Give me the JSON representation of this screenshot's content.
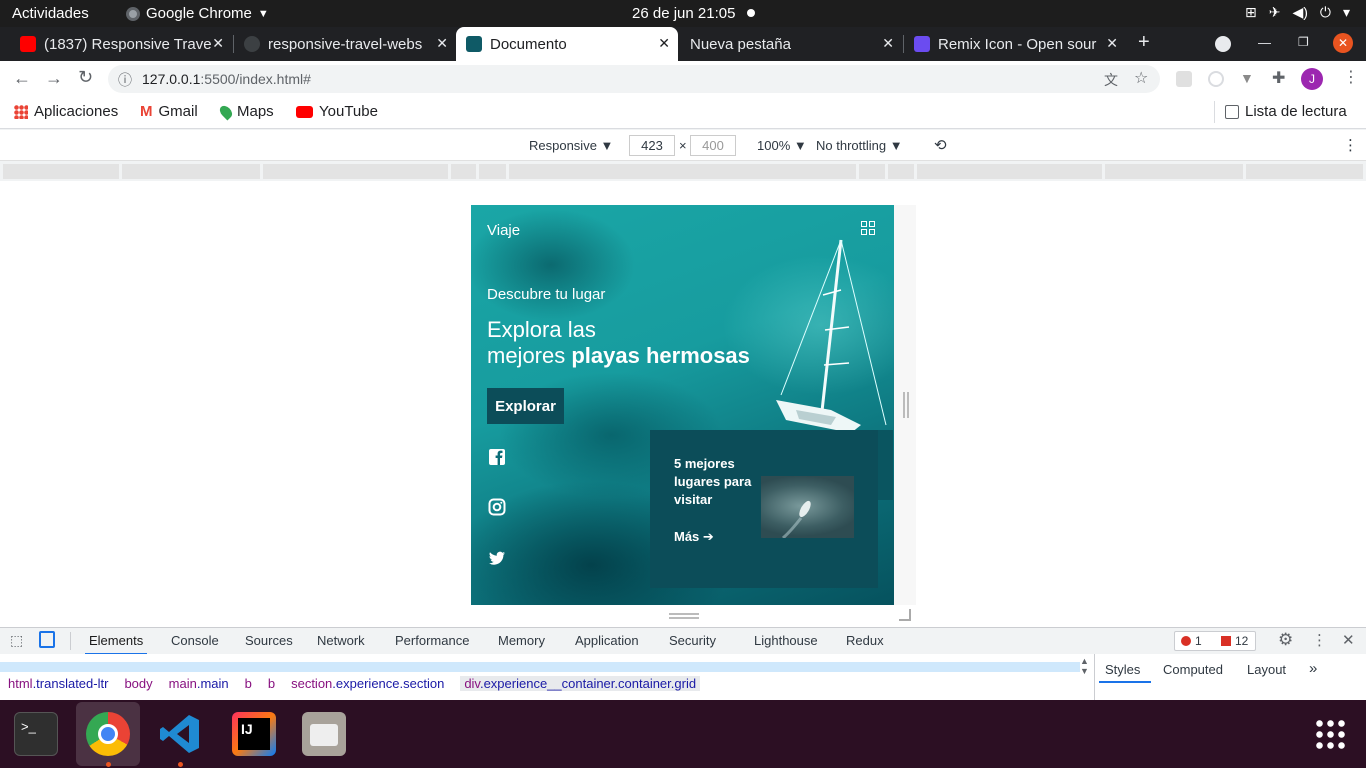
{
  "topbar": {
    "activities": "Actividades",
    "app_name": "Google Chrome",
    "clock": "26 de jun  21:05"
  },
  "tabs": [
    {
      "title": "(1837) Responsive Trave",
      "active": false,
      "favicon_color": "#ff0000"
    },
    {
      "title": "responsive-travel-webs",
      "active": false,
      "favicon_color": "#3c4043"
    },
    {
      "title": "Documento",
      "active": true,
      "favicon_color": "#0f5a66"
    },
    {
      "title": "Nueva pestaña",
      "active": false,
      "favicon_color": ""
    },
    {
      "title": "Remix Icon - Open sour",
      "active": false,
      "favicon_color": "#6b4cf0"
    }
  ],
  "address": {
    "host": "127.0.0.1",
    "path": ":5500/index.html#"
  },
  "bookmarks": {
    "apps": "Aplicaciones",
    "gmail": "Gmail",
    "maps": "Maps",
    "youtube": "YouTube",
    "reading_list": "Lista de lectura"
  },
  "device_toolbar": {
    "device": "Responsive ▼",
    "width": "423",
    "times": "×",
    "height": "400",
    "zoom": "100% ▼",
    "throttling": "No throttling ▼"
  },
  "site": {
    "logo": "Viaje",
    "subtitle": "Descubre tu lugar",
    "title_line1": "Explora las",
    "title_line2_prefix": "mejores ",
    "title_line2_bold": "playas hermosas",
    "button": "Explorar",
    "card_title": "5 mejores lugares para visitar",
    "card_link": "Más ➔"
  },
  "devtools": {
    "tabs": [
      "Elements",
      "Console",
      "Sources",
      "Network",
      "Performance",
      "Memory",
      "Application",
      "Security",
      "Lighthouse",
      "Redux"
    ],
    "errors": "1",
    "warnings": "12",
    "side_tabs": [
      "Styles",
      "Computed",
      "Layout"
    ],
    "breadcrumbs": [
      {
        "tag": "html",
        "cls": ".translated-ltr"
      },
      {
        "tag": "body",
        "cls": ""
      },
      {
        "tag": "main",
        "cls": ".main"
      },
      {
        "tag": "b",
        "cls": ""
      },
      {
        "tag": "b",
        "cls": ""
      },
      {
        "tag": "section",
        "cls": ".experience.section"
      },
      {
        "tag": "div",
        "cls": ".experience__container.container.grid"
      }
    ]
  },
  "colors": {
    "accent": "#1a73e8",
    "site_dark": "#0c4d59",
    "ubuntu_dock": "#2c0f23"
  }
}
